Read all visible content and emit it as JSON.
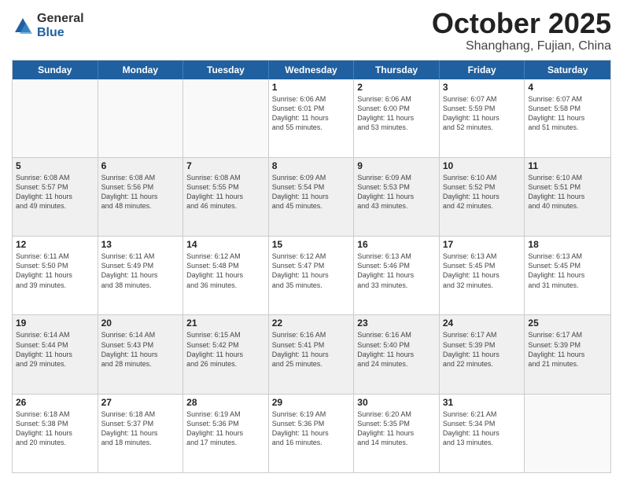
{
  "logo": {
    "general": "General",
    "blue": "Blue"
  },
  "title": "October 2025",
  "location": "Shanghang, Fujian, China",
  "days_of_week": [
    "Sunday",
    "Monday",
    "Tuesday",
    "Wednesday",
    "Thursday",
    "Friday",
    "Saturday"
  ],
  "weeks": [
    [
      {
        "day": "",
        "info": "",
        "empty": true
      },
      {
        "day": "",
        "info": "",
        "empty": true
      },
      {
        "day": "",
        "info": "",
        "empty": true
      },
      {
        "day": "1",
        "info": "Sunrise: 6:06 AM\nSunset: 6:01 PM\nDaylight: 11 hours\nand 55 minutes."
      },
      {
        "day": "2",
        "info": "Sunrise: 6:06 AM\nSunset: 6:00 PM\nDaylight: 11 hours\nand 53 minutes."
      },
      {
        "day": "3",
        "info": "Sunrise: 6:07 AM\nSunset: 5:59 PM\nDaylight: 11 hours\nand 52 minutes."
      },
      {
        "day": "4",
        "info": "Sunrise: 6:07 AM\nSunset: 5:58 PM\nDaylight: 11 hours\nand 51 minutes."
      }
    ],
    [
      {
        "day": "5",
        "info": "Sunrise: 6:08 AM\nSunset: 5:57 PM\nDaylight: 11 hours\nand 49 minutes.",
        "shaded": true
      },
      {
        "day": "6",
        "info": "Sunrise: 6:08 AM\nSunset: 5:56 PM\nDaylight: 11 hours\nand 48 minutes.",
        "shaded": true
      },
      {
        "day": "7",
        "info": "Sunrise: 6:08 AM\nSunset: 5:55 PM\nDaylight: 11 hours\nand 46 minutes.",
        "shaded": true
      },
      {
        "day": "8",
        "info": "Sunrise: 6:09 AM\nSunset: 5:54 PM\nDaylight: 11 hours\nand 45 minutes.",
        "shaded": true
      },
      {
        "day": "9",
        "info": "Sunrise: 6:09 AM\nSunset: 5:53 PM\nDaylight: 11 hours\nand 43 minutes.",
        "shaded": true
      },
      {
        "day": "10",
        "info": "Sunrise: 6:10 AM\nSunset: 5:52 PM\nDaylight: 11 hours\nand 42 minutes.",
        "shaded": true
      },
      {
        "day": "11",
        "info": "Sunrise: 6:10 AM\nSunset: 5:51 PM\nDaylight: 11 hours\nand 40 minutes.",
        "shaded": true
      }
    ],
    [
      {
        "day": "12",
        "info": "Sunrise: 6:11 AM\nSunset: 5:50 PM\nDaylight: 11 hours\nand 39 minutes."
      },
      {
        "day": "13",
        "info": "Sunrise: 6:11 AM\nSunset: 5:49 PM\nDaylight: 11 hours\nand 38 minutes."
      },
      {
        "day": "14",
        "info": "Sunrise: 6:12 AM\nSunset: 5:48 PM\nDaylight: 11 hours\nand 36 minutes."
      },
      {
        "day": "15",
        "info": "Sunrise: 6:12 AM\nSunset: 5:47 PM\nDaylight: 11 hours\nand 35 minutes."
      },
      {
        "day": "16",
        "info": "Sunrise: 6:13 AM\nSunset: 5:46 PM\nDaylight: 11 hours\nand 33 minutes."
      },
      {
        "day": "17",
        "info": "Sunrise: 6:13 AM\nSunset: 5:45 PM\nDaylight: 11 hours\nand 32 minutes."
      },
      {
        "day": "18",
        "info": "Sunrise: 6:13 AM\nSunset: 5:45 PM\nDaylight: 11 hours\nand 31 minutes."
      }
    ],
    [
      {
        "day": "19",
        "info": "Sunrise: 6:14 AM\nSunset: 5:44 PM\nDaylight: 11 hours\nand 29 minutes.",
        "shaded": true
      },
      {
        "day": "20",
        "info": "Sunrise: 6:14 AM\nSunset: 5:43 PM\nDaylight: 11 hours\nand 28 minutes.",
        "shaded": true
      },
      {
        "day": "21",
        "info": "Sunrise: 6:15 AM\nSunset: 5:42 PM\nDaylight: 11 hours\nand 26 minutes.",
        "shaded": true
      },
      {
        "day": "22",
        "info": "Sunrise: 6:16 AM\nSunset: 5:41 PM\nDaylight: 11 hours\nand 25 minutes.",
        "shaded": true
      },
      {
        "day": "23",
        "info": "Sunrise: 6:16 AM\nSunset: 5:40 PM\nDaylight: 11 hours\nand 24 minutes.",
        "shaded": true
      },
      {
        "day": "24",
        "info": "Sunrise: 6:17 AM\nSunset: 5:39 PM\nDaylight: 11 hours\nand 22 minutes.",
        "shaded": true
      },
      {
        "day": "25",
        "info": "Sunrise: 6:17 AM\nSunset: 5:39 PM\nDaylight: 11 hours\nand 21 minutes.",
        "shaded": true
      }
    ],
    [
      {
        "day": "26",
        "info": "Sunrise: 6:18 AM\nSunset: 5:38 PM\nDaylight: 11 hours\nand 20 minutes."
      },
      {
        "day": "27",
        "info": "Sunrise: 6:18 AM\nSunset: 5:37 PM\nDaylight: 11 hours\nand 18 minutes."
      },
      {
        "day": "28",
        "info": "Sunrise: 6:19 AM\nSunset: 5:36 PM\nDaylight: 11 hours\nand 17 minutes."
      },
      {
        "day": "29",
        "info": "Sunrise: 6:19 AM\nSunset: 5:36 PM\nDaylight: 11 hours\nand 16 minutes."
      },
      {
        "day": "30",
        "info": "Sunrise: 6:20 AM\nSunset: 5:35 PM\nDaylight: 11 hours\nand 14 minutes."
      },
      {
        "day": "31",
        "info": "Sunrise: 6:21 AM\nSunset: 5:34 PM\nDaylight: 11 hours\nand 13 minutes."
      },
      {
        "day": "",
        "info": "",
        "empty": true
      }
    ]
  ]
}
